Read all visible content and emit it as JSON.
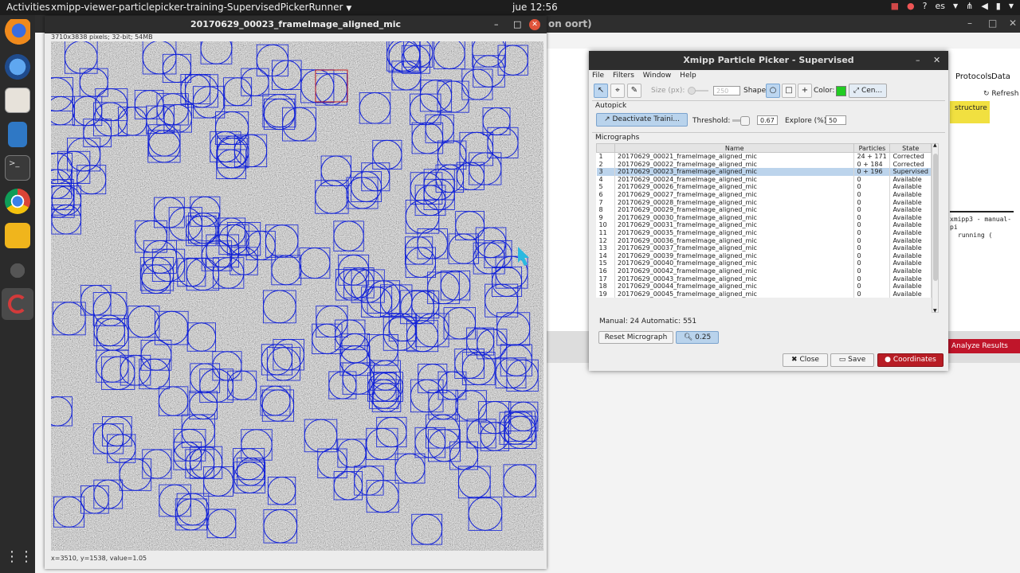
{
  "topbar": {
    "activities": "Activities",
    "app_menu": "xmipp-viewer-particlepicker-training-SupervisedPickerRunner",
    "clock": "jue 12:56",
    "lang": "es"
  },
  "background_window": {
    "title": "on oort)",
    "menu_protocols": "Protocols",
    "menu_data": "Data",
    "refresh": "Refresh",
    "badge": "structure",
    "term_line1": "xmipp3 - manual-pi",
    "term_line2": "running (",
    "analyze": "Analyze Results"
  },
  "image_window": {
    "title": "20170629_00023_frameImage_aligned_mic",
    "info": "3710x3838 pixels; 32-bit; 54MB",
    "status": "x=3510, y=1538, value=1.05"
  },
  "picker": {
    "title": "Xmipp Particle Picker - Supervised",
    "menu": [
      "File",
      "Filters",
      "Window",
      "Help"
    ],
    "toolbar": {
      "size_label": "Size (px):",
      "size_value": "250",
      "shape_label": "Shape:",
      "color_label": "Color:",
      "color_value": "#22cc22",
      "center_label": "Cen..."
    },
    "autopick": {
      "section": "Autopick",
      "deactivate": "Deactivate Traini...",
      "threshold_label": "Threshold:",
      "threshold_value": "0.67",
      "threshold_fraction": 0.67,
      "explore_label": "Explore (%):",
      "explore_value": "50"
    },
    "micrographs": {
      "section": "Micrographs",
      "columns": [
        "",
        "Name",
        "Particles",
        "State"
      ],
      "rows": [
        [
          "1",
          "20170629_00021_frameImage_aligned_mic",
          "24 + 171",
          "Corrected"
        ],
        [
          "2",
          "20170629_00022_frameImage_aligned_mic",
          "0 + 184",
          "Corrected"
        ],
        [
          "3",
          "20170629_00023_frameImage_aligned_mic",
          "0 + 196",
          "Supervised"
        ],
        [
          "4",
          "20170629_00024_frameImage_aligned_mic",
          "0",
          "Available"
        ],
        [
          "5",
          "20170629_00026_frameImage_aligned_mic",
          "0",
          "Available"
        ],
        [
          "6",
          "20170629_00027_frameImage_aligned_mic",
          "0",
          "Available"
        ],
        [
          "7",
          "20170629_00028_frameImage_aligned_mic",
          "0",
          "Available"
        ],
        [
          "8",
          "20170629_00029_frameImage_aligned_mic",
          "0",
          "Available"
        ],
        [
          "9",
          "20170629_00030_frameImage_aligned_mic",
          "0",
          "Available"
        ],
        [
          "10",
          "20170629_00031_frameImage_aligned_mic",
          "0",
          "Available"
        ],
        [
          "11",
          "20170629_00035_frameImage_aligned_mic",
          "0",
          "Available"
        ],
        [
          "12",
          "20170629_00036_frameImage_aligned_mic",
          "0",
          "Available"
        ],
        [
          "13",
          "20170629_00037_frameImage_aligned_mic",
          "0",
          "Available"
        ],
        [
          "14",
          "20170629_00039_frameImage_aligned_mic",
          "0",
          "Available"
        ],
        [
          "15",
          "20170629_00040_frameImage_aligned_mic",
          "0",
          "Available"
        ],
        [
          "16",
          "20170629_00042_frameImage_aligned_mic",
          "0",
          "Available"
        ],
        [
          "17",
          "20170629_00043_frameImage_aligned_mic",
          "0",
          "Available"
        ],
        [
          "18",
          "20170629_00044_frameImage_aligned_mic",
          "0",
          "Available"
        ],
        [
          "19",
          "20170629_00045_frameImage_aligned_mic",
          "0",
          "Available"
        ]
      ],
      "selected_row": 3
    },
    "summary": "Manual: 24 Automatic: 551",
    "reset": "Reset Micrograph",
    "zoom": "0.25",
    "close": "Close",
    "save": "Save",
    "coordinates": "Coordinates"
  }
}
